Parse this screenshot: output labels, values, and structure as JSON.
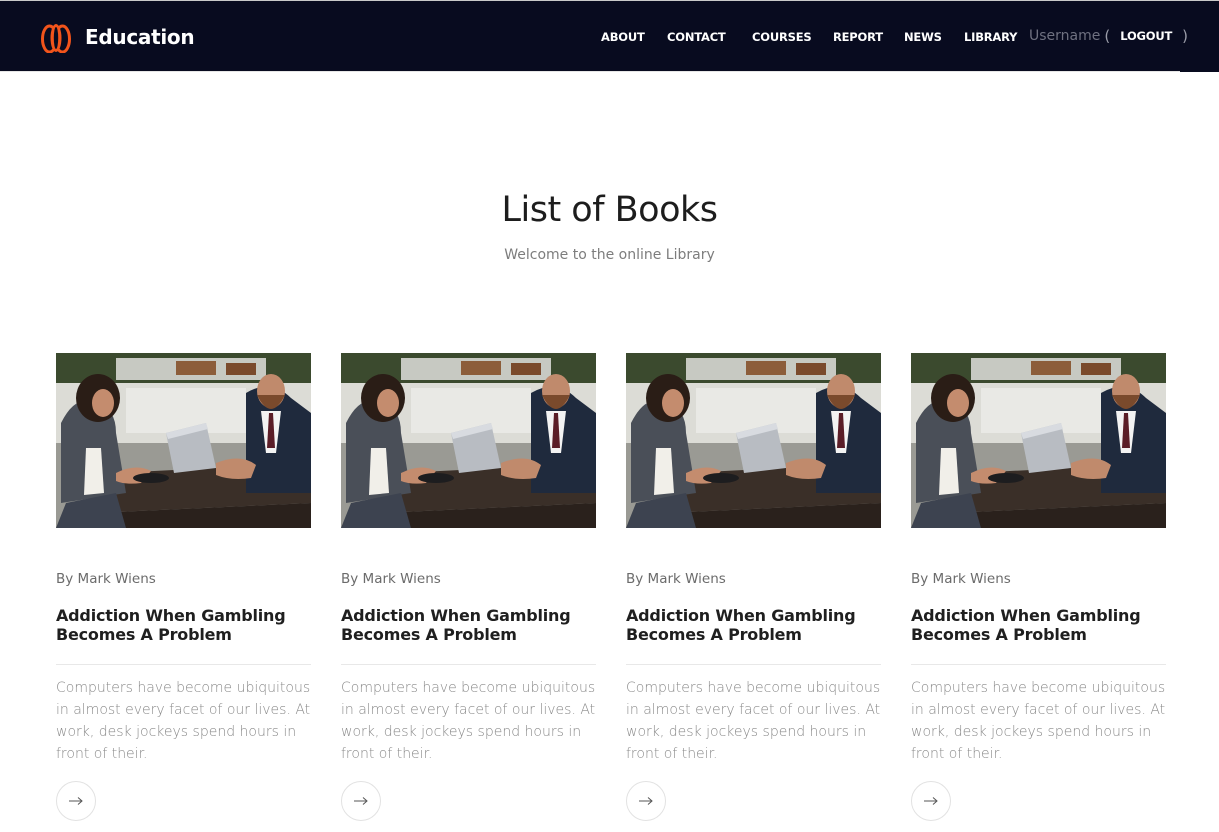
{
  "header": {
    "brand_name": "Education",
    "logo_icon": "flame-petal-logo",
    "nav": [
      {
        "label": "ABOUT"
      },
      {
        "label": "CONTACT"
      },
      {
        "label": "COURSES"
      },
      {
        "label": "REPORT"
      },
      {
        "label": "NEWS"
      },
      {
        "label": "LIBRARY"
      }
    ],
    "username": "Username",
    "paren_open": "(",
    "logout_label": "LOGOUT",
    "paren_close": ")"
  },
  "main": {
    "title": "List of Books",
    "subtitle": "Welcome to the online Library"
  },
  "cards": [
    {
      "author": "By Mark Wiens",
      "title": "Addiction When Gambling Becomes A Problem",
      "excerpt": "Computers have become ubiquitous in almost every facet of our lives. At work, desk jockeys spend hours in front of their.",
      "arrow_icon": "arrow-right-icon"
    },
    {
      "author": "By Mark Wiens",
      "title": "Addiction When Gambling Becomes A Problem",
      "excerpt": "Computers have become ubiquitous in almost every facet of our lives. At work, desk jockeys spend hours in front of their.",
      "arrow_icon": "arrow-right-icon"
    },
    {
      "author": "By Mark Wiens",
      "title": "Addiction When Gambling Becomes A Problem",
      "excerpt": "Computers have become ubiquitous in almost every facet of our lives. At work, desk jockeys spend hours in front of their.",
      "arrow_icon": "arrow-right-icon"
    },
    {
      "author": "By Mark Wiens",
      "title": "Addiction When Gambling Becomes A Problem",
      "excerpt": "Computers have become ubiquitous in almost every facet of our lives. At work, desk jockeys spend hours in front of their.",
      "arrow_icon": "arrow-right-icon"
    }
  ],
  "colors": {
    "header_bg": "#080b1f",
    "logo_orange": "#f2541b",
    "heading": "#1d1d1d",
    "muted_text": "#8a8a8a"
  }
}
